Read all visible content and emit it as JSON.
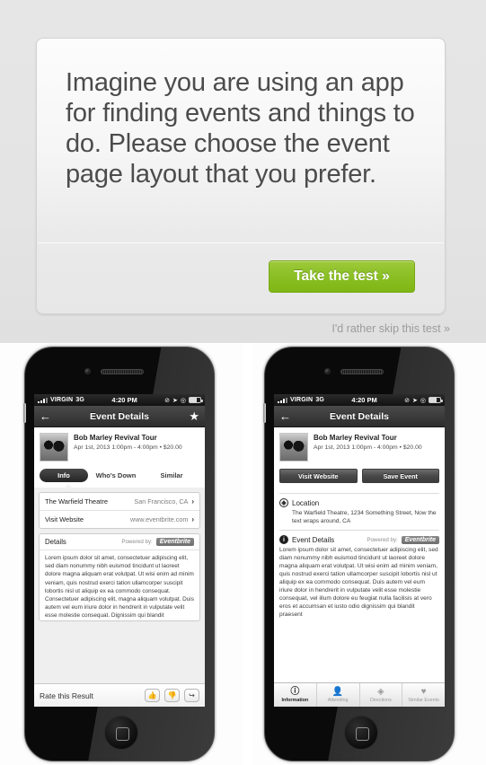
{
  "prompt": {
    "question": "Imagine you are using an app for finding events and things to do. Please choose the event page layout that you prefer.",
    "cta_label": "Take the test »",
    "skip_label": "I'd rather skip this test »",
    "accent_color": "#8cc026",
    "page_background": "#e4e4e4"
  },
  "phone_common": {
    "status_bar": {
      "carrier": "VIRGIN",
      "network": "3G",
      "time": "4:20 PM",
      "lock_icon": "rotation-lock-icon",
      "location_icon": "location-arrow-icon",
      "battery_icon": "battery-icon"
    },
    "nav": {
      "title": "Event Details",
      "back_icon": "back-arrow-icon",
      "star_icon": "star-icon"
    },
    "event": {
      "title": "Bob Marley Revival Tour",
      "subtitle": "Apr 1st, 2013 1:00pm - 4:00pm  •  $20.00",
      "thumbnail": "event-photo"
    },
    "powered_by_label": "Powered by:",
    "powered_by_brand": "Eventbrite"
  },
  "option_a": {
    "tabs": [
      {
        "label": "Info",
        "active": true
      },
      {
        "label": "Who's Down",
        "active": false
      },
      {
        "label": "Similar",
        "active": false
      }
    ],
    "rows": [
      {
        "label": "The Warfield Theatre",
        "value": "San Francisco, CA",
        "chevron": "›"
      },
      {
        "label": "Visit Website",
        "value": "www.eventbrite.com",
        "chevron": "›"
      }
    ],
    "details_title": "Details",
    "details_body": "Lorem ipsum dolor sit amet, consectetuer adipiscing elit, sed diam nonummy nibh euismod tincidunt ut laoreet dolore magna aliquam erat volutpat. Ut wisi enim ad minim veniam, quis nostrud exerci tation ullamcorper suscipit lobortis nisl ut aliquip ex ea commodo consequat. Consectetuer adipiscing elit,  magna aliquam volutpat. Duis autem vel eum iriure dolor in hendrerit in vulputate velit esse molestie consequat. Dignissim qui blandit",
    "rate_label": "Rate this Result",
    "rate_buttons": [
      {
        "icon": "thumbs-up-icon",
        "glyph": "👍"
      },
      {
        "icon": "thumbs-down-icon",
        "glyph": "👎"
      },
      {
        "icon": "share-icon",
        "glyph": "↪"
      }
    ]
  },
  "option_b": {
    "actions": [
      {
        "label": "Visit Website"
      },
      {
        "label": "Save Event"
      }
    ],
    "location": {
      "icon": "compass-icon",
      "title": "Location",
      "body": "The Warfield Theatre, 1234 Something Street, Now the text wraps around, CA"
    },
    "details": {
      "icon": "info-icon",
      "title": "Event Details",
      "body": "Lorem ipsum dolor sit amet, consectetuer adipiscing elit, sed diam nonummy nibh euismod tincidunt ut laoreet dolore magna aliquam erat volutpat. Ut wisi enim ad minim veniam, quis nostrud exerci tation ullamcorper suscipit lobortis nisl ut aliquip ex ea commodo consequat. Duis autem vel eum iriure dolor in hendrerit in vulputate velit esse molestie consequat, vel illum dolore eu feugiat nulla facilisis at vero eros et accumsan et iusto odio dignissim qui blandit praesent"
    },
    "tab_bar": [
      {
        "label": "Information",
        "icon": "info-icon",
        "glyph": "ⓘ",
        "active": true
      },
      {
        "label": "Attending",
        "icon": "person-add-icon",
        "glyph": "👤",
        "active": false
      },
      {
        "label": "Directions",
        "icon": "compass-icon",
        "glyph": "◈",
        "active": false
      },
      {
        "label": "Similar Events",
        "icon": "heart-icon",
        "glyph": "♥",
        "active": false
      }
    ]
  }
}
